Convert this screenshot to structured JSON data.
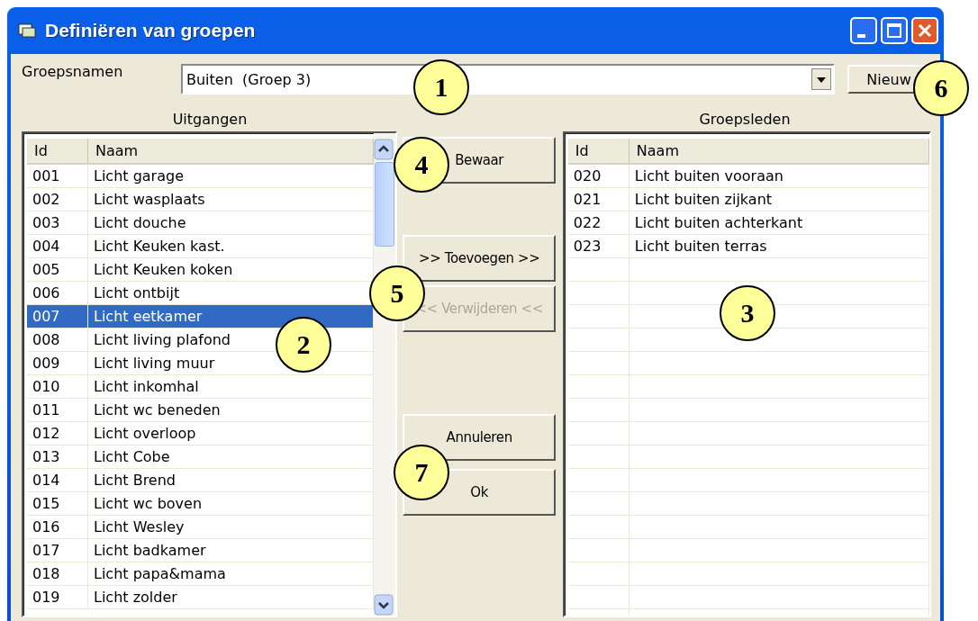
{
  "window": {
    "title": "Definiëren van groepen"
  },
  "group_names": {
    "label": "Groepsnamen",
    "value": "Buiten  (Groep 3)",
    "new_button": "Nieuw"
  },
  "outputs": {
    "title": "Uitgangen",
    "columns": [
      "Id",
      "Naam"
    ],
    "rows": [
      {
        "id": "001",
        "name": "Licht garage",
        "selected": false
      },
      {
        "id": "002",
        "name": "Licht wasplaats",
        "selected": false
      },
      {
        "id": "003",
        "name": "Licht douche",
        "selected": false
      },
      {
        "id": "004",
        "name": "Licht Keuken kast.",
        "selected": false
      },
      {
        "id": "005",
        "name": "Licht Keuken koken",
        "selected": false
      },
      {
        "id": "006",
        "name": "Licht ontbijt",
        "selected": false
      },
      {
        "id": "007",
        "name": "Licht eetkamer",
        "selected": true
      },
      {
        "id": "008",
        "name": "Licht living plafond",
        "selected": false
      },
      {
        "id": "009",
        "name": "Licht living muur",
        "selected": false
      },
      {
        "id": "010",
        "name": "Licht inkomhal",
        "selected": false
      },
      {
        "id": "011",
        "name": "Licht wc beneden",
        "selected": false
      },
      {
        "id": "012",
        "name": "Licht overloop",
        "selected": false
      },
      {
        "id": "013",
        "name": "Licht Cobe",
        "selected": false
      },
      {
        "id": "014",
        "name": "Licht Brend",
        "selected": false
      },
      {
        "id": "015",
        "name": "Licht wc boven",
        "selected": false
      },
      {
        "id": "016",
        "name": "Licht Wesley",
        "selected": false
      },
      {
        "id": "017",
        "name": "Licht badkamer",
        "selected": false
      },
      {
        "id": "018",
        "name": "Licht papa&mama",
        "selected": false
      },
      {
        "id": "019",
        "name": "Licht zolder",
        "selected": false
      }
    ]
  },
  "buttons": [
    {
      "label": "Bewaar",
      "disabled": false
    },
    {
      "label": ">> Toevoegen >>",
      "disabled": false
    },
    {
      "label": "<< Verwijderen <<",
      "disabled": true
    },
    {
      "label": "Annuleren",
      "disabled": false
    },
    {
      "label": "Ok",
      "disabled": false
    }
  ],
  "members": {
    "title": "Groepsleden",
    "columns": [
      "Id",
      "Naam"
    ],
    "rows": [
      {
        "id": "020",
        "name": "Licht buiten vooraan",
        "selected": false
      },
      {
        "id": "021",
        "name": "Licht buiten zijkant",
        "selected": false
      },
      {
        "id": "022",
        "name": "Licht buiten achterkant",
        "selected": false
      },
      {
        "id": "023",
        "name": "Licht buiten terras",
        "selected": false
      }
    ]
  },
  "callouts": [
    "1",
    "2",
    "3",
    "4",
    "5",
    "6",
    "7"
  ]
}
